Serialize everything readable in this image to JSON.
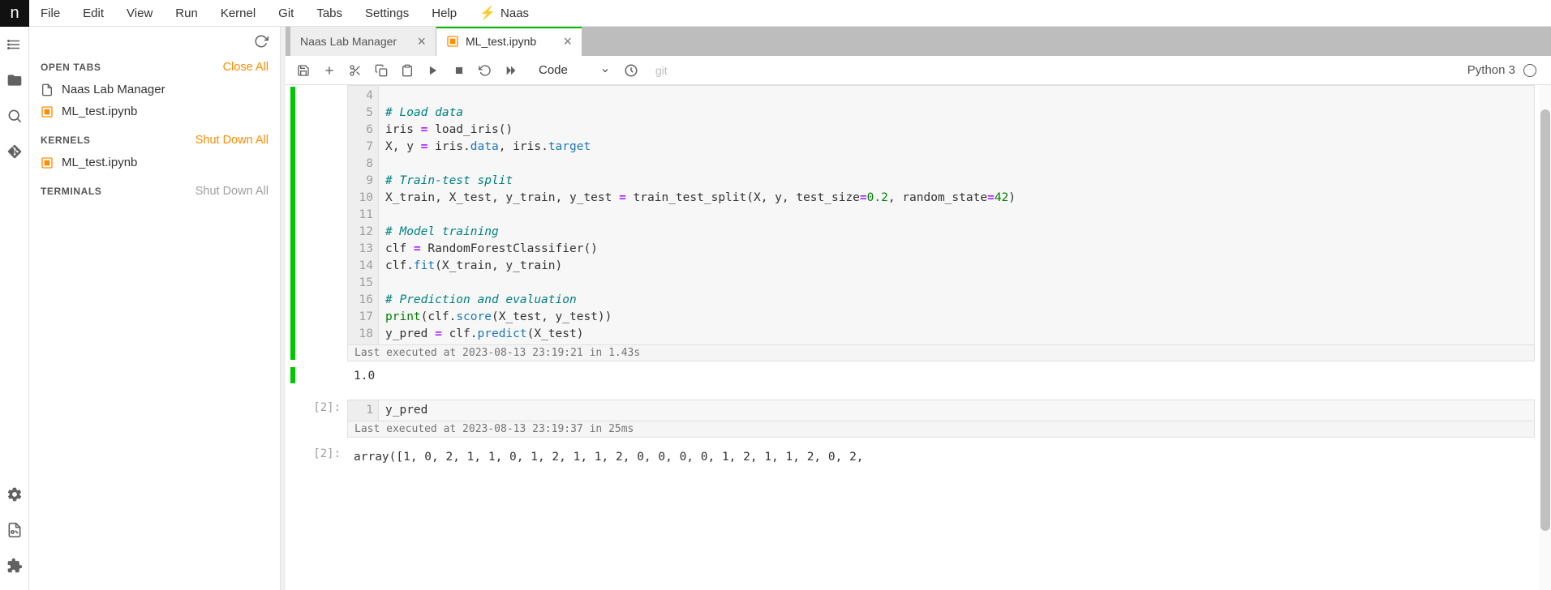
{
  "menu": [
    "File",
    "Edit",
    "View",
    "Run",
    "Kernel",
    "Git",
    "Tabs",
    "Settings",
    "Help"
  ],
  "naas_label": "Naas",
  "sidebar": {
    "open_tabs": {
      "title": "OPEN TABS",
      "action": "Close All"
    },
    "tabs": [
      {
        "icon": "doc",
        "label": "Naas Lab Manager"
      },
      {
        "icon": "nb",
        "label": "ML_test.ipynb"
      }
    ],
    "kernels": {
      "title": "KERNELS",
      "action": "Shut Down All"
    },
    "kernel_items": [
      {
        "icon": "nb",
        "label": "ML_test.ipynb"
      }
    ],
    "terminals": {
      "title": "TERMINALS",
      "action": "Shut Down All"
    }
  },
  "doc_tabs": [
    {
      "label": "Naas Lab Manager",
      "active": false
    },
    {
      "label": "ML_test.ipynb",
      "active": true,
      "icon": "nb",
      "activity": true
    }
  ],
  "toolbar": {
    "cell_type": "Code",
    "git": "git",
    "kernel_name": "Python 3"
  },
  "cell1": {
    "prompt": "",
    "gutter_start": 4,
    "lines": [
      {
        "n": 4,
        "html": ""
      },
      {
        "n": 5,
        "html": "<span class='tok-comment'># Load data</span>"
      },
      {
        "n": 6,
        "html": "iris <span class='tok-op'>=</span> load_iris()"
      },
      {
        "n": 7,
        "html": "X, y <span class='tok-op'>=</span> iris.<span class='tok-attr'>data</span>, iris.<span class='tok-attr'>target</span>"
      },
      {
        "n": 8,
        "html": ""
      },
      {
        "n": 9,
        "html": "<span class='tok-comment'># Train-test split</span>"
      },
      {
        "n": 10,
        "html": "X_train, X_test, y_train, y_test <span class='tok-op'>=</span> train_test_split(X, y, test_size<span class='tok-op'>=</span><span class='tok-num'>0.2</span>, random_state<span class='tok-op'>=</span><span class='tok-num'>42</span>)"
      },
      {
        "n": 11,
        "html": ""
      },
      {
        "n": 12,
        "html": "<span class='tok-comment'># Model training</span>"
      },
      {
        "n": 13,
        "html": "clf <span class='tok-op'>=</span> RandomForestClassifier()"
      },
      {
        "n": 14,
        "html": "clf.<span class='tok-attr'>fit</span>(X_train, y_train)"
      },
      {
        "n": 15,
        "html": ""
      },
      {
        "n": 16,
        "html": "<span class='tok-comment'># Prediction and evaluation</span>"
      },
      {
        "n": 17,
        "html": "<span class='tok-builtin'>print</span>(clf.<span class='tok-attr'>score</span>(X_test, y_test))"
      },
      {
        "n": 18,
        "html": "y_pred <span class='tok-op'>=</span> clf.<span class='tok-attr'>predict</span>(X_test)"
      }
    ],
    "exec_info": "Last executed at 2023-08-13 23:19:21 in 1.43s",
    "output": "1.0"
  },
  "cell2": {
    "prompt": "[2]:",
    "lines": [
      {
        "n": 1,
        "html": "y_pred"
      }
    ],
    "exec_info": "Last executed at 2023-08-13 23:19:37 in 25ms"
  },
  "out2": {
    "prompt": "[2]:",
    "text": "array([1, 0, 2, 1, 1, 0, 1, 2, 1, 1, 2, 0, 0, 0, 0, 1, 2, 1, 1, 2, 0, 2,"
  }
}
